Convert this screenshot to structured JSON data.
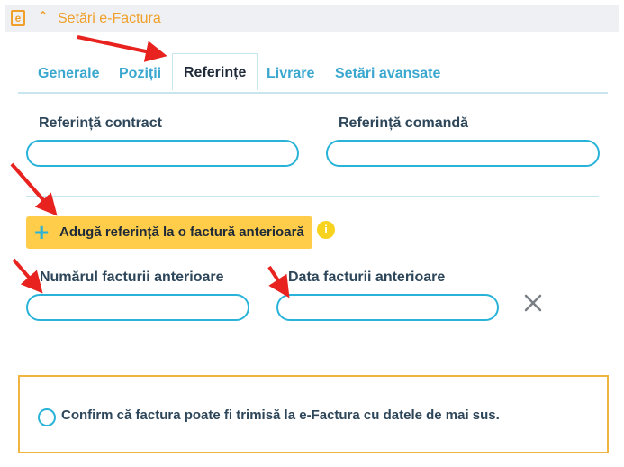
{
  "panel": {
    "title": "Setări e-Factura",
    "icon": "e-factura-icon",
    "icon_letter": "e",
    "collapse_icon": "chevron-up-icon"
  },
  "tabs": [
    {
      "label": "Generale",
      "active": false
    },
    {
      "label": "Poziții",
      "active": false
    },
    {
      "label": "Referințe",
      "active": true
    },
    {
      "label": "Livrare",
      "active": false
    },
    {
      "label": "Setări avansate",
      "active": false
    }
  ],
  "fields": {
    "contract_label": "Referință contract",
    "contract_value": "",
    "order_label": "Referință comandă",
    "order_value": "",
    "prev_invoice_number_label": "Numărul facturii anterioare",
    "prev_invoice_number_value": "",
    "prev_invoice_date_label": "Data facturii anterioare",
    "prev_invoice_date_value": ""
  },
  "add_reference_button": {
    "label": "Adugă referință la o factură anterioară",
    "icon": "plus-icon"
  },
  "info": {
    "icon": "info-icon",
    "glyph": "i"
  },
  "remove": {
    "icon": "close-icon"
  },
  "confirm": {
    "text": "Confirm că factura poate fi trimisă la e-Factura cu datele de mai sus.",
    "checked": false
  },
  "colors": {
    "accent_orange": "#f0a02a",
    "tab_blue": "#3aa7cf",
    "input_border": "#29b3d9",
    "button_yellow": "#ffcd4a",
    "annotation_red": "#e8231f"
  }
}
